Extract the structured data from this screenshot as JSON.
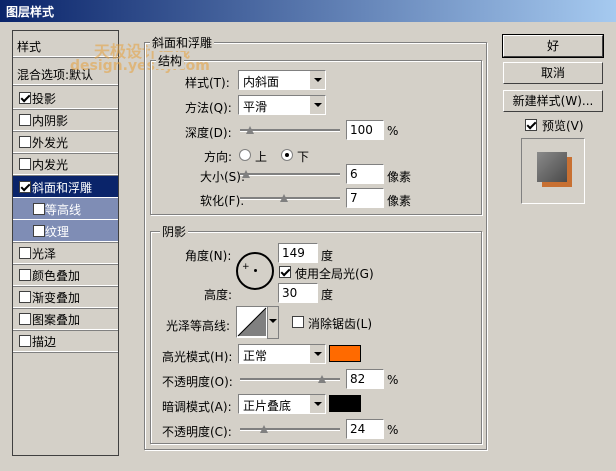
{
  "window": {
    "title": "图层样式"
  },
  "sidebar": {
    "header": "样式",
    "blend_default": "混合选项:默认",
    "items": [
      {
        "label": "投影",
        "checked": true
      },
      {
        "label": "内阴影",
        "checked": false
      },
      {
        "label": "外发光",
        "checked": false
      },
      {
        "label": "内发光",
        "checked": false
      },
      {
        "label": "斜面和浮雕",
        "checked": true,
        "selected": true
      },
      {
        "label": "等高线",
        "checked": false,
        "sub": true
      },
      {
        "label": "纹理",
        "checked": false,
        "sub": true
      },
      {
        "label": "光泽",
        "checked": false
      },
      {
        "label": "颜色叠加",
        "checked": false
      },
      {
        "label": "渐变叠加",
        "checked": false
      },
      {
        "label": "图案叠加",
        "checked": false
      },
      {
        "label": "描边",
        "checked": false
      }
    ]
  },
  "bevel": {
    "section_title": "斜面和浮雕",
    "structure_title": "结构",
    "style_label": "样式(T):",
    "style_value": "内斜面",
    "technique_label": "方法(Q):",
    "technique_value": "平滑",
    "depth_label": "深度(D):",
    "depth_value": "100",
    "depth_unit": "%",
    "direction_label": "方向:",
    "direction_up": "上",
    "direction_down": "下",
    "size_label": "大小(S):",
    "size_value": "6",
    "size_unit": "像素",
    "soften_label": "软化(F):",
    "soften_value": "7",
    "soften_unit": "像素"
  },
  "shading": {
    "title": "阴影",
    "angle_label": "角度(N):",
    "angle_value": "149",
    "angle_unit": "度",
    "global_light_label": "使用全局光(G)",
    "altitude_label": "高度:",
    "altitude_value": "30",
    "altitude_unit": "度",
    "gloss_label": "光泽等高线:",
    "antialias_label": "消除锯齿(L)",
    "highlight_mode_label": "高光模式(H):",
    "highlight_mode_value": "正常",
    "highlight_color": "#ff6a00",
    "highlight_opacity_label": "不透明度(O):",
    "highlight_opacity_value": "82",
    "highlight_opacity_unit": "%",
    "shadow_mode_label": "暗调模式(A):",
    "shadow_mode_value": "正片叠底",
    "shadow_color": "#000000",
    "shadow_opacity_label": "不透明度(C):",
    "shadow_opacity_value": "24",
    "shadow_opacity_unit": "%"
  },
  "buttons": {
    "ok": "好",
    "cancel": "取消",
    "new_style": "新建样式(W)...",
    "preview": "预览(V)"
  },
  "watermark": {
    "line1": "天极设计在线",
    "line2": "design.yesky.com"
  }
}
